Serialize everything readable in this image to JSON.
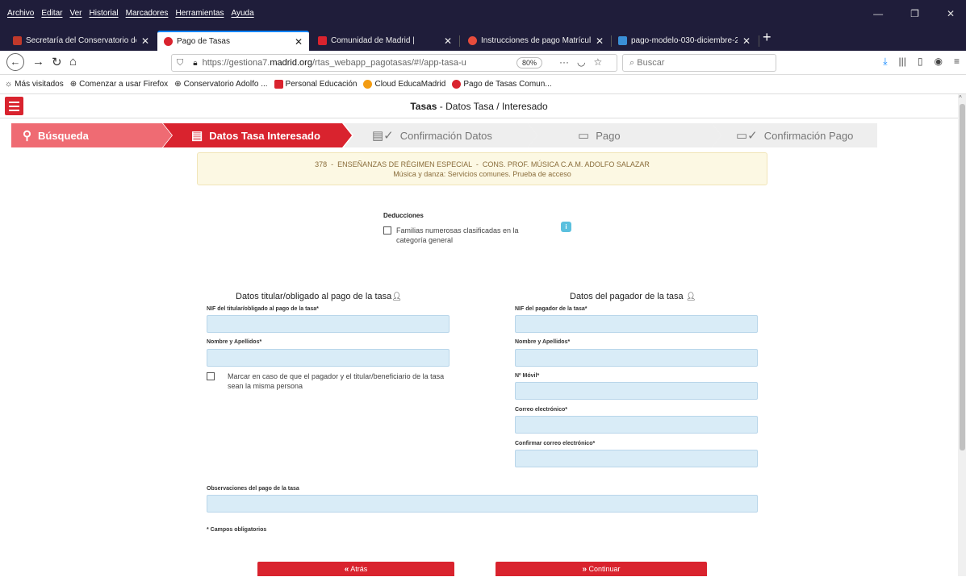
{
  "browser": {
    "menu": [
      "Archivo",
      "Editar",
      "Ver",
      "Historial",
      "Marcadores",
      "Herramientas",
      "Ayuda"
    ],
    "window_controls": [
      "—",
      "❐",
      "✕"
    ],
    "tabs": [
      {
        "label": "Secretaría del Conservatorio de",
        "icon_color": "#c0392b"
      },
      {
        "label": "Pago de Tasas",
        "icon_color": "#d9232e"
      },
      {
        "label": "Comunidad de Madrid |",
        "icon_color": "#d9232e"
      },
      {
        "label": "Instrucciones de pago Matrícul",
        "icon_color": "#e74c3c"
      },
      {
        "label": "pago-modelo-030-diciembre-2",
        "icon_color": "#3a8fd6"
      }
    ],
    "url": {
      "prefix": "https://gestiona7.",
      "domain": "madrid.org",
      "path": "/rtas_webapp_pagotasas/#!/app-tasa-u",
      "zoom": "80%"
    },
    "search_placeholder": "Buscar",
    "bookmarks": [
      {
        "label": "Más visitados",
        "color": "#666"
      },
      {
        "label": "Comenzar a usar Firefox",
        "color": "#666"
      },
      {
        "label": "Conservatorio Adolfo ...",
        "color": "#666"
      },
      {
        "label": "Personal Educación",
        "color": "#d9232e"
      },
      {
        "label": "Cloud EducaMadrid",
        "color": "#f39c12"
      },
      {
        "label": "Pago de Tasas Comun...",
        "color": "#d9232e"
      }
    ]
  },
  "header": {
    "title_bold": "Tasas",
    "title_rest": " - Datos Tasa / Interesado"
  },
  "steps": [
    {
      "label": "Búsqueda",
      "icon": "search-icon",
      "state": "on"
    },
    {
      "label": "Datos Tasa Interesado",
      "icon": "id-card-icon",
      "state": "on"
    },
    {
      "label": "Confirmación Datos",
      "icon": "id-card-check-icon",
      "state": "off"
    },
    {
      "label": "Pago",
      "icon": "credit-card-icon",
      "state": "off"
    },
    {
      "label": "Confirmación Pago",
      "icon": "credit-card-check-icon",
      "state": "off"
    }
  ],
  "info": {
    "line1": "378  -  ENSEÑANZAS DE RÉGIMEN ESPECIAL  -  CONS. PROF. MÚSICA C.A.M. ADOLFO SALAZAR",
    "line2": "Música y danza: Servicios comunes. Prueba de acceso"
  },
  "deducciones": {
    "title": "Deducciones",
    "option": "Familias numerosas clasificadas en la categoría general",
    "info_icon_label": "i"
  },
  "titular": {
    "title": "Datos titular/obligado al pago de la tasa",
    "nif_label": "NIF del titular/obligado al pago de la tasa*",
    "nombre_label": "Nombre y Apellidos*",
    "same_person": "Marcar en caso de que el pagador y el titular/beneficiario de la tasa sean la misma persona"
  },
  "pagador": {
    "title": "Datos del pagador de la tasa",
    "nif_label": "NIF del pagador de la tasa*",
    "nombre_label": "Nombre y Apellidos*",
    "movil_label": "Nº Móvil*",
    "correo_label": "Correo electrónico*",
    "confirmar_label": "Confirmar correo electrónico*"
  },
  "observaciones_label": "Observaciones del pago de la tasa",
  "required_note": "* Campos obligatorios",
  "buttons": {
    "back": "Atrás",
    "continue": "Continuar"
  },
  "colors": {
    "brand_red": "#d9232e",
    "input_bg": "#d9ecf7",
    "info_bg": "#fcf8e3"
  }
}
